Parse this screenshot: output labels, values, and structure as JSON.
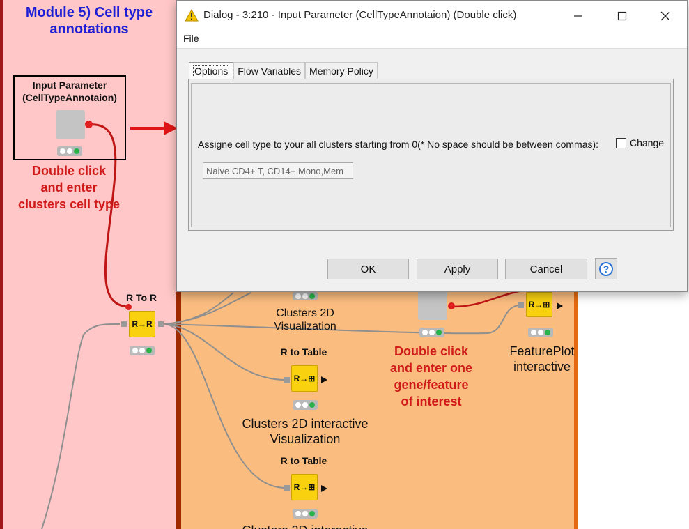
{
  "workflow": {
    "module_title_line1": "Module 5)  Cell type",
    "module_title_line2": "annotations",
    "input_node": {
      "label_line1": "Input Parameter",
      "label_line2": "(CellTypeAnnotaion)"
    },
    "input_hint": [
      "Double click",
      "and enter",
      "clusters cell type"
    ],
    "r_to_r_label": "R To R",
    "r_to_r_icon": "R→R",
    "clusters_2d_label": [
      "Clusters 2D",
      "Visualization"
    ],
    "r_to_table_1": "R to Table",
    "clusters_2d_interactive_label": [
      "Clusters  2D interactive",
      "Visualization"
    ],
    "r_to_table_2": "R to Table",
    "bottom_cut_label": "Clusters  2D interactive",
    "gene_hint": [
      "Double click",
      "and enter one",
      "gene/feature",
      "of interest"
    ],
    "featureplot_label": [
      "FeaturePlot",
      "interactive"
    ],
    "r_to_table_icon": "R→⊞",
    "colors": {
      "left_module_bg": "#ffc7c7",
      "orange_module_bg": "#fbbd7f",
      "node_yellow": "#f9d10f",
      "annotation_red": "#d01a1a",
      "title_blue": "#1f1fd6"
    }
  },
  "dialog": {
    "title": "Dialog - 3:210 - Input Parameter (CellTypeAnnotaion) (Double click)",
    "window_icon": "warning-triangle-icon",
    "menu": {
      "file": "File"
    },
    "tabs": [
      "Options",
      "Flow Variables",
      "Memory Policy"
    ],
    "active_tab": "Options",
    "param_label": "Assigne cell type to your all clusters starting from 0(* No space should be between commas):",
    "change_label": "Change",
    "change_checked": false,
    "input_value": "Naive CD4+ T, CD14+ Mono,Mem",
    "buttons": {
      "ok": "OK",
      "apply": "Apply",
      "cancel": "Cancel",
      "help": "?"
    }
  }
}
